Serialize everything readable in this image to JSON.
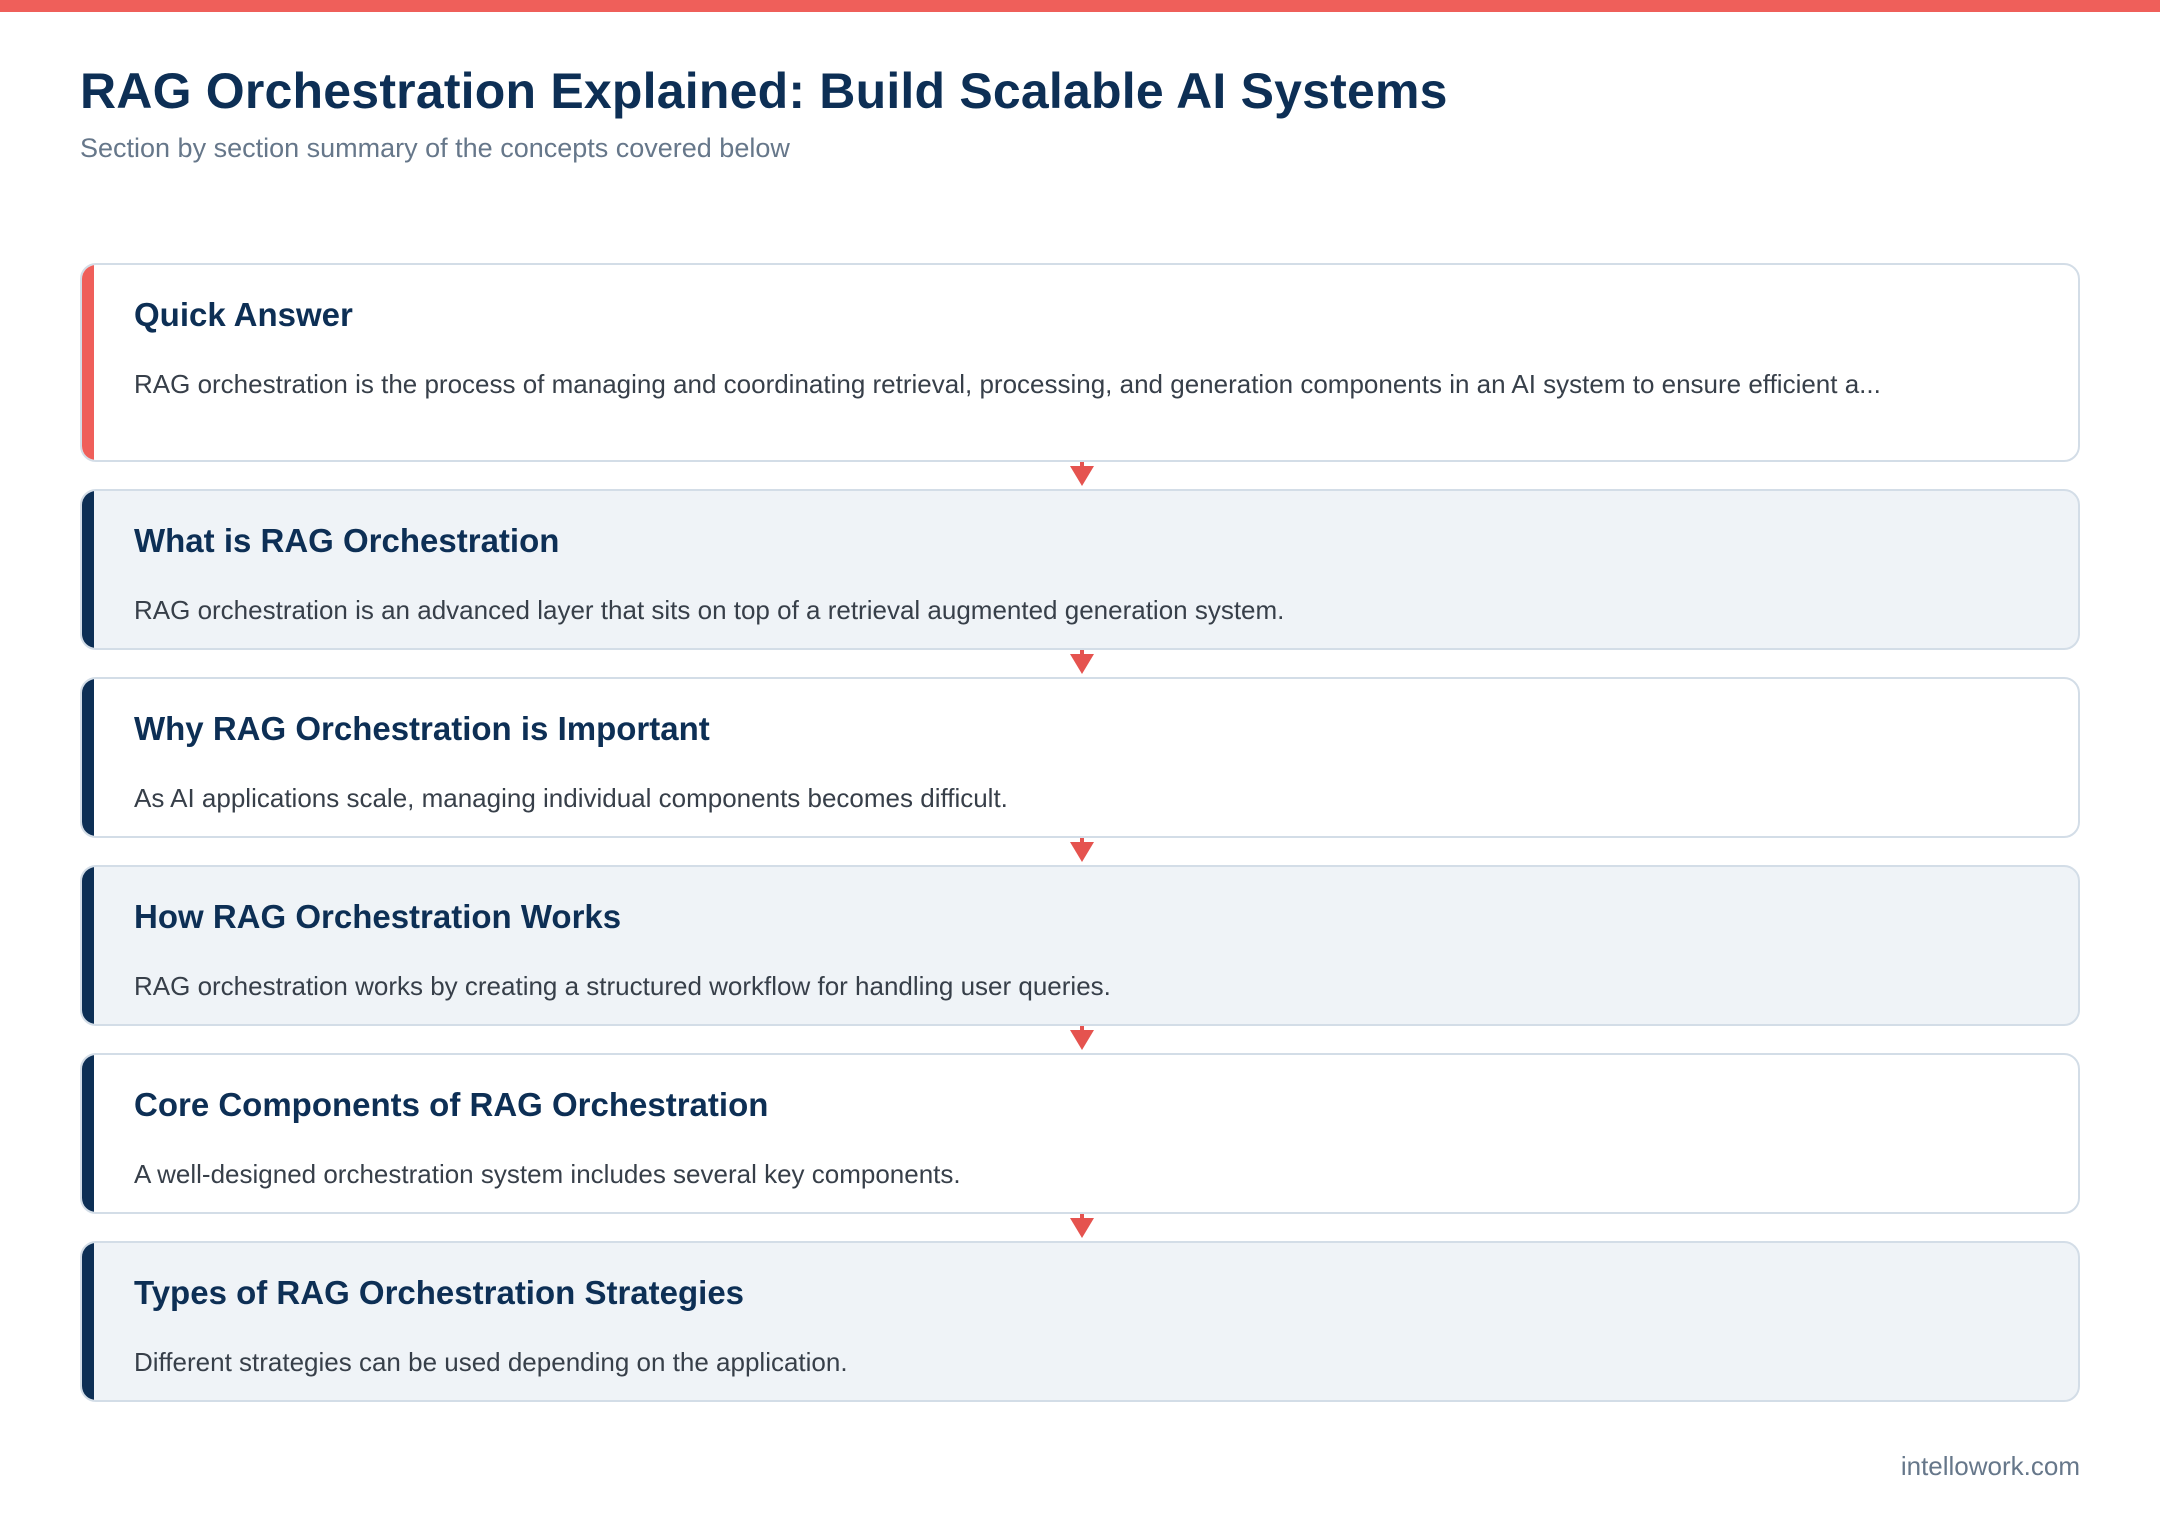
{
  "header": {
    "title": "RAG Orchestration Explained: Build Scalable AI Systems",
    "subtitle": "Section by section summary of the concepts covered below"
  },
  "colors": {
    "accent": "#ef5f5a",
    "navy": "#0d2f55",
    "card_alt_bg": "#eff3f7"
  },
  "cards": [
    {
      "title": "Quick Answer",
      "body": "RAG orchestration is the process of managing and coordinating retrieval, processing, and generation components in an AI system to ensure efficient a..."
    },
    {
      "title": "What is RAG Orchestration",
      "body": "RAG orchestration is an advanced layer that sits on top of a retrieval augmented generation system."
    },
    {
      "title": "Why RAG Orchestration is Important",
      "body": "As AI applications scale, managing individual components becomes difficult."
    },
    {
      "title": "How RAG Orchestration Works",
      "body": "RAG orchestration works by creating a structured workflow for handling user queries."
    },
    {
      "title": "Core Components of RAG Orchestration",
      "body": "A well-designed orchestration system includes several key components."
    },
    {
      "title": "Types of RAG Orchestration Strategies",
      "body": "Different strategies can be used depending on the application."
    }
  ],
  "footer": {
    "source": "intellowork.com"
  }
}
